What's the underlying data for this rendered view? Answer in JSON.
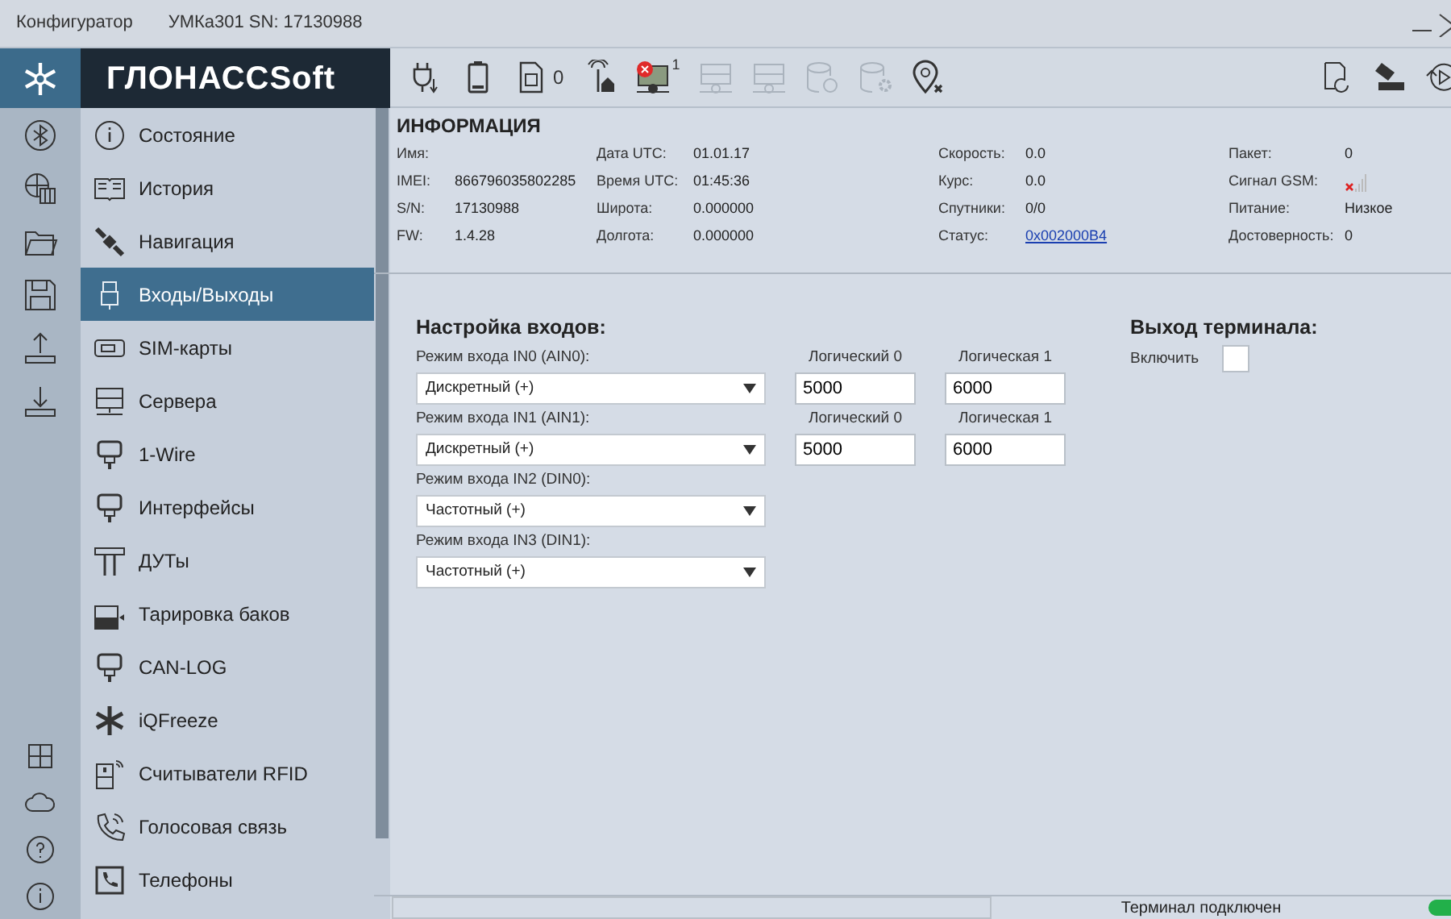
{
  "window": {
    "title": "Конфигуратор",
    "device": "УМКа301 SN: 17130988"
  },
  "logo": {
    "text": "ГЛОНАССSoft"
  },
  "toolbar": {
    "left": [
      {
        "kind": "plug",
        "disabled": false
      },
      {
        "kind": "battery",
        "disabled": false
      },
      {
        "kind": "sim",
        "disabled": false,
        "label": "0"
      },
      {
        "kind": "antenna",
        "disabled": false
      },
      {
        "kind": "server-error",
        "disabled": false,
        "label": "1"
      },
      {
        "kind": "server",
        "disabled": true
      },
      {
        "kind": "server",
        "disabled": true
      },
      {
        "kind": "database-refresh",
        "disabled": true
      },
      {
        "kind": "database-gear",
        "disabled": true
      },
      {
        "kind": "pin-x",
        "disabled": false
      }
    ],
    "right": [
      {
        "kind": "file-refresh",
        "disabled": false
      },
      {
        "kind": "stamp",
        "disabled": false
      },
      {
        "kind": "play-refresh",
        "disabled": false
      }
    ]
  },
  "sidebar": {
    "items": [
      {
        "label": "Состояние",
        "selected": false
      },
      {
        "label": "История",
        "selected": false
      },
      {
        "label": "Навигация",
        "selected": false
      },
      {
        "label": "Входы/Выходы",
        "selected": true
      },
      {
        "label": "SIM-карты",
        "selected": false
      },
      {
        "label": "Сервера",
        "selected": false
      },
      {
        "label": "1-Wire",
        "selected": false
      },
      {
        "label": "Интерфейсы",
        "selected": false
      },
      {
        "label": "ДУТы",
        "selected": false
      },
      {
        "label": "Тарировка баков",
        "selected": false
      },
      {
        "label": "CAN-LOG",
        "selected": false
      },
      {
        "label": "iQFreeze",
        "selected": false
      },
      {
        "label": "Считыватели RFID",
        "selected": false
      },
      {
        "label": "Голосовая связь",
        "selected": false
      },
      {
        "label": "Телефоны",
        "selected": false
      }
    ]
  },
  "info": {
    "title": "ИНФОРМАЦИЯ",
    "columns": [
      [
        {
          "label": "Имя:"
        },
        {
          "label": "IMEI:",
          "value": "866796035802285"
        },
        {
          "label": "S/N:",
          "value": "17130988"
        },
        {
          "label": "FW:",
          "value": "1.4.28"
        }
      ],
      [
        {
          "label": "Дата UTC:",
          "value": "01.01.17"
        },
        {
          "label": "Время UTC:",
          "value": "01:45:36"
        },
        {
          "label": "Широта:",
          "value": "0.000000"
        },
        {
          "label": "Долгота:",
          "value": "0.000000"
        }
      ],
      [
        {
          "label": "Скорость:",
          "value": "0.0"
        },
        {
          "label": "Курс:",
          "value": "0.0"
        },
        {
          "label": "Спутники:",
          "value": "0/0"
        },
        {
          "label": "Статус:",
          "value": "0x002000B4",
          "kind": "link"
        }
      ],
      [
        {
          "label": "Пакет:",
          "value": "0"
        },
        {
          "label": "Сигнал GSM:",
          "kind": "signal"
        },
        {
          "label": "Питание:",
          "value": "Низкое"
        },
        {
          "label": "Достоверность:",
          "value": "0"
        }
      ]
    ]
  },
  "inputs": {
    "title": "Настройка входов:",
    "rows": [
      {
        "label": "Режим входа IN0 (AIN0):",
        "mode": "Дискретный (+)",
        "logic0_label": "Логический 0",
        "logic0": "5000",
        "logic1_label": "Логическая 1",
        "logic1": "6000"
      },
      {
        "label": "Режим входа IN1 (AIN1):",
        "mode": "Дискретный (+)",
        "logic0_label": "Логический 0",
        "logic0": "5000",
        "logic1_label": "Логическая 1",
        "logic1": "6000"
      },
      {
        "label": "Режим входа IN2 (DIN0):",
        "mode": "Частотный (+)"
      },
      {
        "label": "Режим входа IN3 (DIN1):",
        "mode": "Частотный (+)"
      }
    ]
  },
  "output": {
    "title": "Выход терминала:",
    "enable_label": "Включить",
    "checked": false
  },
  "status_bar": {
    "text": "Терминал подключен",
    "connected": true
  }
}
